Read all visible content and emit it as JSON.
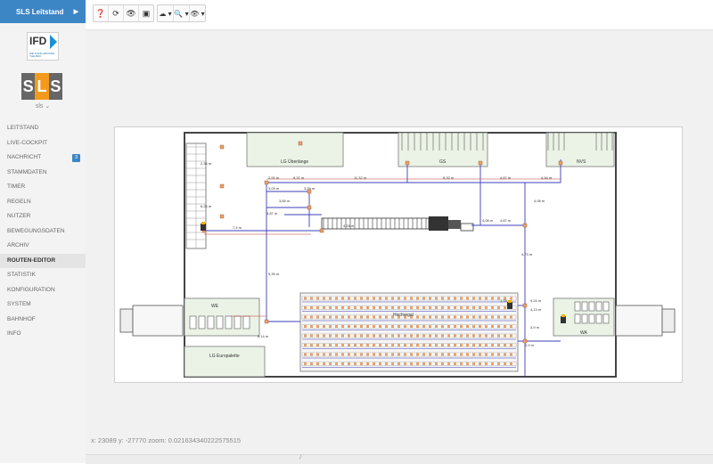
{
  "app": {
    "title": "SLS Leitstand"
  },
  "logos": {
    "ifd_text": "IFD",
    "ifd_tagline": "WE THINK AROUND THE BOX",
    "sls_letters": [
      "S",
      "L",
      "S"
    ]
  },
  "user": {
    "label": "sls ⌄"
  },
  "nav": {
    "items": [
      {
        "label": "LEITSTAND"
      },
      {
        "label": "LIVE-COCKPIT"
      },
      {
        "label": "NACHRICHT",
        "badge": "3"
      },
      {
        "label": "STAMMDATEN"
      },
      {
        "label": "TIMER"
      },
      {
        "label": "REGELN"
      },
      {
        "label": "NUTZER"
      },
      {
        "label": "BEWEGUNGSDATEN"
      },
      {
        "label": "ARCHIV"
      },
      {
        "label": "ROUTEN-EDITOR",
        "active": true
      },
      {
        "label": "STATISTIK"
      },
      {
        "label": "KONFIGURATION"
      },
      {
        "label": "SYSTEM"
      },
      {
        "label": "BAHNHOF"
      },
      {
        "label": "INFO"
      }
    ]
  },
  "toolbar": {
    "buttons": [
      {
        "icon": "help-icon",
        "glyph": "❓"
      },
      {
        "icon": "refresh-icon",
        "glyph": "⟳"
      },
      {
        "icon": "eye-icon",
        "glyph": "👁"
      },
      {
        "icon": "image-icon",
        "glyph": "▣"
      }
    ],
    "dropdowns": [
      {
        "icon": "cloud-icon",
        "glyph": "☁ ▾"
      },
      {
        "icon": "zoom-icon",
        "glyph": "🔍 ▾"
      },
      {
        "icon": "visibility-icon",
        "glyph": "👁 ▾"
      }
    ]
  },
  "status": {
    "coords": "x: 23089 y: -27770 zoom: 0.021634340222575515"
  },
  "footer": {
    "mark": "/"
  },
  "map": {
    "areas": {
      "lg_uberlange": "LG Überlänge",
      "gs": "GS",
      "nvs": "NVS",
      "hochregal": "Hochregal",
      "we": "WE",
      "wa": "WA",
      "lg_europalette": "LG Europalette"
    },
    "distances": [
      "2,91 m",
      "8,37 m",
      "11,32 m",
      "8,32 m",
      "4,87 m",
      "4,54 m",
      "3,09 m",
      "3,09 m",
      "3,65 m",
      "3,87 m",
      "4,08 m",
      "4,87 m",
      "4,08 m",
      "7,4 m",
      "5,39 m",
      "4,73 m",
      "4,33 m",
      "9,24 m",
      "4,13 m",
      "2,9 m",
      "6,14 m",
      "1,24 m",
      "3,9 m",
      "2,35 m",
      "6,24 m"
    ],
    "colors": {
      "route": "#3b3fb8",
      "route_red": "#c0392b",
      "shelf": "#e8a06a",
      "area_fill": "#eaf3e6"
    }
  }
}
